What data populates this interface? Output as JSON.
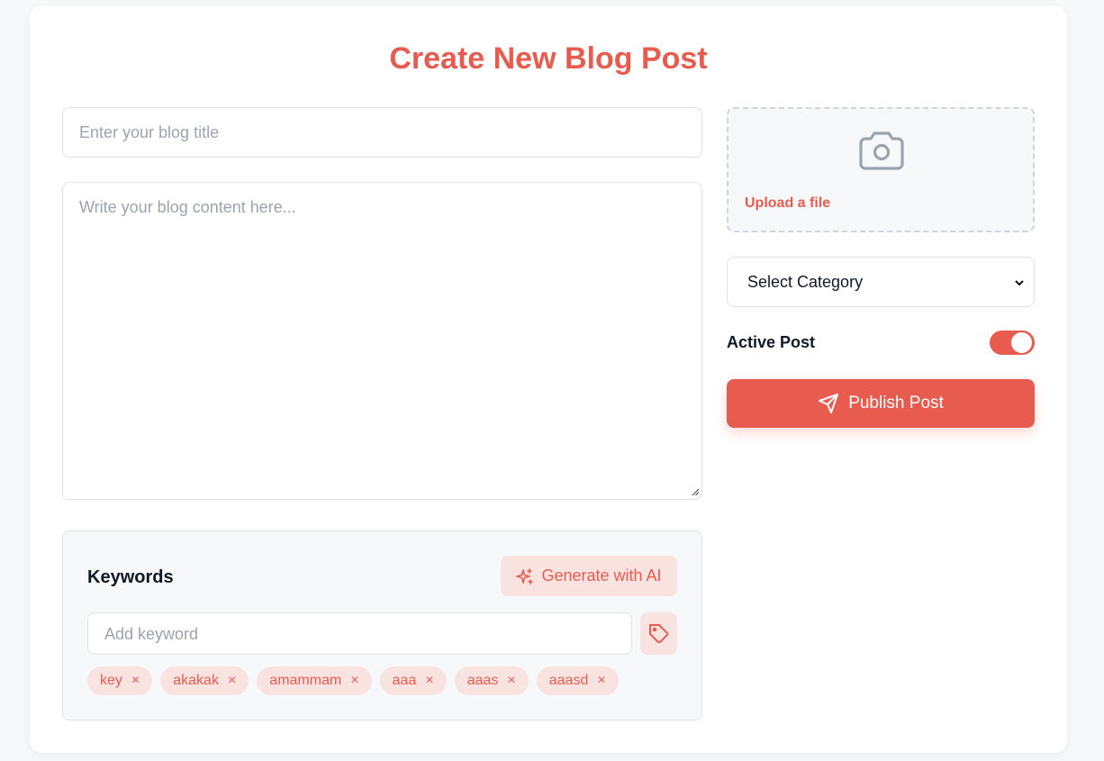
{
  "page": {
    "title": "Create New Blog Post"
  },
  "form": {
    "title_placeholder": "Enter your blog title",
    "content_placeholder": "Write your blog content here..."
  },
  "upload": {
    "icon": "camera-icon",
    "link_label": "Upload a file"
  },
  "category": {
    "selected": "Select Category"
  },
  "active_toggle": {
    "label": "Active Post",
    "on": true
  },
  "publish": {
    "label": "Publish Post",
    "icon": "send-icon"
  },
  "keywords": {
    "heading": "Keywords",
    "generate_label": "Generate with AI",
    "input_placeholder": "Add keyword",
    "add_icon": "tag-icon",
    "chips": [
      {
        "label": "key",
        "remove": "×"
      },
      {
        "label": "akakak",
        "remove": "×"
      },
      {
        "label": "amammam",
        "remove": "×"
      },
      {
        "label": "aaa",
        "remove": "×"
      },
      {
        "label": "aaas",
        "remove": "×"
      },
      {
        "label": "aaasd",
        "remove": "×"
      }
    ]
  },
  "colors": {
    "accent": "#e85b4f",
    "accent_soft": "#f9e3e1",
    "border": "#dfe2e7",
    "muted": "#9ca3af"
  }
}
